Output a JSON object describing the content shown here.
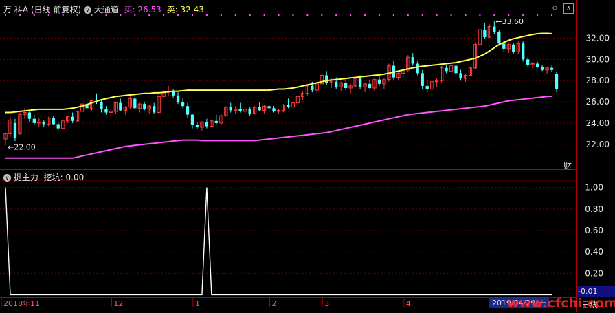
{
  "header": {
    "stock": "万 科A",
    "mode": "(日线 前复权)",
    "indicator": "大通道",
    "buy_label": "买:",
    "buy_value": "26.53",
    "sell_label": "卖:",
    "sell_value": "32.43"
  },
  "finance_tag": "财",
  "lower_header": {
    "indicator": "捉主力",
    "label": "挖坑:",
    "value": "0.00"
  },
  "bottom": {
    "months": [
      "2018年11",
      "12",
      "1",
      "2",
      "3",
      "4"
    ],
    "date_tag": "2019/04/29(一",
    "period": "日线",
    "small_value": "-0.01"
  },
  "watermark": "www.cfchi.com",
  "colors": {
    "background": "#000000",
    "up": "#ff3d3d",
    "down": "#55ffff",
    "upper_band": "#ffff55",
    "lower_band": "#ff55ff",
    "dots": "#ff55ff",
    "axis": "#b00000"
  },
  "chart_data": [
    {
      "type": "candlestick",
      "title": "大通道",
      "ylim": [
        20.3,
        34.3
      ],
      "yticks": [
        22.0,
        24.0,
        26.0,
        28.0,
        30.0,
        32.0
      ],
      "ytick_labels": [
        "22.00",
        "24.00",
        "26.00",
        "28.00",
        "30.00",
        "32.00"
      ],
      "annotations": {
        "high": "33.60",
        "low": "22.00"
      },
      "candles": [
        [
          22.5,
          23.1,
          21.9,
          23.0
        ],
        [
          23.0,
          24.6,
          22.7,
          24.3
        ],
        [
          24.0,
          24.4,
          22.3,
          22.6
        ],
        [
          23.0,
          25.0,
          22.9,
          24.8
        ],
        [
          24.8,
          25.4,
          24.4,
          25.0
        ],
        [
          25.0,
          25.2,
          24.1,
          24.4
        ],
        [
          24.4,
          24.8,
          23.8,
          24.0
        ],
        [
          24.0,
          24.5,
          23.6,
          24.1
        ],
        [
          24.1,
          24.3,
          23.6,
          23.9
        ],
        [
          23.9,
          24.6,
          23.7,
          24.5
        ],
        [
          24.5,
          24.7,
          23.8,
          23.9
        ],
        [
          23.9,
          24.1,
          23.3,
          23.5
        ],
        [
          23.5,
          24.3,
          23.4,
          24.2
        ],
        [
          24.2,
          24.7,
          24.0,
          24.6
        ],
        [
          24.6,
          25.0,
          24.0,
          24.2
        ],
        [
          24.2,
          25.2,
          24.1,
          25.1
        ],
        [
          25.1,
          26.0,
          24.9,
          25.8
        ],
        [
          25.8,
          26.4,
          25.2,
          25.4
        ],
        [
          25.4,
          26.2,
          25.1,
          26.1
        ],
        [
          26.1,
          26.8,
          25.8,
          26.0
        ],
        [
          26.0,
          26.2,
          25.0,
          25.3
        ],
        [
          25.3,
          25.6,
          24.8,
          25.0
        ],
        [
          25.0,
          25.3,
          24.6,
          25.1
        ],
        [
          25.1,
          26.0,
          24.9,
          25.9
        ],
        [
          25.9,
          26.3,
          25.1,
          25.2
        ],
        [
          25.2,
          25.6,
          24.8,
          25.5
        ],
        [
          25.5,
          26.5,
          25.3,
          26.3
        ],
        [
          26.3,
          26.7,
          25.3,
          25.4
        ],
        [
          25.4,
          25.9,
          25.0,
          25.8
        ],
        [
          25.8,
          26.0,
          25.2,
          25.3
        ],
        [
          25.3,
          25.7,
          24.9,
          25.6
        ],
        [
          25.6,
          25.9,
          24.9,
          25.0
        ],
        [
          25.0,
          26.7,
          24.9,
          26.5
        ],
        [
          26.5,
          27.1,
          26.3,
          26.9
        ],
        [
          26.9,
          27.5,
          26.5,
          27.0
        ],
        [
          27.0,
          27.2,
          26.4,
          26.6
        ],
        [
          26.6,
          26.9,
          25.8,
          26.0
        ],
        [
          26.0,
          26.3,
          25.4,
          25.6
        ],
        [
          25.6,
          25.9,
          24.5,
          24.8
        ],
        [
          24.8,
          24.9,
          23.5,
          23.8
        ],
        [
          23.8,
          24.1,
          23.4,
          23.6
        ],
        [
          23.6,
          24.2,
          23.3,
          24.1
        ],
        [
          24.1,
          24.4,
          23.5,
          23.7
        ],
        [
          23.7,
          24.3,
          23.6,
          24.2
        ],
        [
          24.2,
          24.8,
          23.9,
          24.0
        ],
        [
          24.0,
          24.9,
          23.8,
          24.7
        ],
        [
          24.7,
          25.6,
          24.6,
          25.5
        ],
        [
          25.5,
          25.9,
          25.0,
          25.2
        ],
        [
          25.2,
          25.6,
          24.9,
          25.3
        ],
        [
          25.3,
          25.9,
          25.0,
          25.1
        ],
        [
          25.1,
          25.4,
          24.8,
          25.3
        ],
        [
          25.3,
          25.5,
          24.7,
          24.9
        ],
        [
          24.9,
          25.6,
          24.8,
          25.5
        ],
        [
          25.5,
          26.0,
          25.1,
          25.2
        ],
        [
          25.2,
          25.7,
          24.9,
          25.6
        ],
        [
          25.6,
          25.8,
          25.0,
          25.4
        ],
        [
          25.4,
          25.6,
          25.0,
          25.1
        ],
        [
          25.1,
          25.3,
          24.9,
          25.2
        ],
        [
          25.2,
          25.8,
          25.0,
          25.7
        ],
        [
          25.7,
          26.3,
          25.4,
          25.5
        ],
        [
          25.5,
          26.0,
          25.3,
          25.9
        ],
        [
          25.9,
          26.6,
          25.8,
          26.5
        ],
        [
          26.5,
          27.0,
          26.2,
          26.8
        ],
        [
          26.8,
          27.6,
          26.6,
          27.5
        ],
        [
          27.5,
          27.9,
          26.9,
          27.1
        ],
        [
          27.1,
          27.8,
          26.7,
          27.7
        ],
        [
          27.7,
          28.7,
          27.5,
          28.5
        ],
        [
          28.5,
          28.9,
          27.6,
          27.8
        ],
        [
          27.8,
          28.2,
          27.3,
          27.9
        ],
        [
          27.9,
          28.3,
          27.2,
          27.4
        ],
        [
          27.4,
          27.9,
          27.0,
          27.8
        ],
        [
          27.8,
          28.1,
          27.1,
          27.3
        ],
        [
          27.3,
          27.7,
          26.8,
          27.5
        ],
        [
          27.5,
          28.3,
          27.4,
          28.2
        ],
        [
          28.2,
          28.5,
          27.2,
          27.4
        ],
        [
          27.4,
          27.8,
          26.9,
          27.7
        ],
        [
          27.7,
          28.1,
          27.2,
          27.3
        ],
        [
          27.3,
          28.3,
          27.0,
          28.1
        ],
        [
          28.1,
          28.6,
          27.5,
          27.7
        ],
        [
          27.7,
          28.2,
          27.2,
          28.1
        ],
        [
          28.1,
          29.6,
          27.9,
          29.4
        ],
        [
          29.4,
          29.9,
          28.1,
          28.3
        ],
        [
          28.3,
          28.9,
          28.0,
          28.7
        ],
        [
          28.7,
          29.2,
          28.3,
          29.0
        ],
        [
          29.0,
          30.4,
          28.8,
          30.2
        ],
        [
          30.2,
          30.6,
          29.4,
          29.6
        ],
        [
          29.6,
          29.9,
          28.5,
          28.7
        ],
        [
          28.7,
          29.0,
          27.2,
          27.5
        ],
        [
          27.5,
          28.0,
          26.9,
          27.2
        ],
        [
          27.2,
          28.1,
          27.0,
          27.9
        ],
        [
          27.9,
          28.2,
          27.4,
          28.0
        ],
        [
          28.0,
          29.4,
          27.8,
          29.2
        ],
        [
          29.2,
          29.5,
          28.7,
          28.9
        ],
        [
          28.9,
          29.6,
          28.8,
          29.4
        ],
        [
          29.4,
          29.8,
          28.5,
          28.7
        ],
        [
          28.7,
          29.0,
          28.0,
          28.2
        ],
        [
          28.2,
          28.6,
          27.9,
          28.5
        ],
        [
          28.5,
          29.3,
          28.4,
          29.2
        ],
        [
          29.2,
          31.6,
          29.1,
          31.4
        ],
        [
          31.4,
          33.0,
          31.2,
          32.8
        ],
        [
          32.8,
          33.4,
          31.9,
          32.1
        ],
        [
          32.1,
          33.3,
          32.0,
          33.1
        ],
        [
          33.1,
          33.6,
          32.4,
          32.6
        ],
        [
          32.6,
          32.8,
          31.3,
          31.5
        ],
        [
          31.5,
          31.8,
          30.7,
          31.0
        ],
        [
          31.0,
          31.6,
          30.6,
          31.4
        ],
        [
          31.4,
          31.5,
          30.5,
          30.7
        ],
        [
          30.7,
          31.7,
          30.5,
          31.5
        ],
        [
          31.5,
          31.7,
          29.8,
          30.0
        ],
        [
          30.0,
          30.2,
          29.3,
          29.5
        ],
        [
          29.5,
          29.8,
          29.1,
          29.6
        ],
        [
          29.6,
          29.8,
          29.2,
          29.3
        ],
        [
          29.3,
          29.5,
          28.9,
          29.0
        ],
        [
          29.0,
          29.3,
          28.6,
          29.2
        ],
        [
          29.2,
          29.4,
          28.8,
          29.0
        ],
        [
          28.6,
          28.8,
          26.9,
          27.2
        ]
      ],
      "upper_band": [
        25.0,
        25.0,
        25.05,
        25.1,
        25.15,
        25.2,
        25.25,
        25.3,
        25.3,
        25.3,
        25.3,
        25.3,
        25.3,
        25.35,
        25.4,
        25.5,
        25.6,
        25.75,
        25.9,
        26.05,
        26.2,
        26.3,
        26.4,
        26.5,
        26.55,
        26.6,
        26.65,
        26.7,
        26.75,
        26.8,
        26.8,
        26.85,
        26.85,
        26.9,
        26.95,
        27.0,
        27.0,
        27.05,
        27.1,
        27.1,
        27.1,
        27.1,
        27.1,
        27.1,
        27.1,
        27.1,
        27.1,
        27.1,
        27.1,
        27.1,
        27.1,
        27.1,
        27.1,
        27.1,
        27.1,
        27.1,
        27.15,
        27.2,
        27.2,
        27.25,
        27.3,
        27.4,
        27.5,
        27.6,
        27.7,
        27.8,
        27.9,
        28.0,
        28.05,
        28.1,
        28.15,
        28.2,
        28.25,
        28.3,
        28.35,
        28.4,
        28.45,
        28.5,
        28.55,
        28.6,
        28.7,
        28.8,
        28.9,
        29.0,
        29.1,
        29.2,
        29.3,
        29.35,
        29.4,
        29.45,
        29.5,
        29.55,
        29.6,
        29.65,
        29.7,
        29.8,
        29.9,
        30.0,
        30.1,
        30.3,
        30.5,
        30.8,
        31.1,
        31.4,
        31.6,
        31.8,
        31.95,
        32.05,
        32.15,
        32.25,
        32.35,
        32.42,
        32.45,
        32.45,
        32.43
      ],
      "lower_band": [
        20.7,
        20.7,
        20.7,
        20.7,
        20.7,
        20.7,
        20.7,
        20.7,
        20.7,
        20.7,
        20.7,
        20.7,
        20.7,
        20.7,
        20.7,
        20.8,
        20.9,
        21.0,
        21.1,
        21.2,
        21.3,
        21.4,
        21.5,
        21.6,
        21.7,
        21.8,
        21.85,
        21.9,
        21.95,
        22.0,
        22.05,
        22.1,
        22.15,
        22.2,
        22.25,
        22.3,
        22.35,
        22.4,
        22.4,
        22.4,
        22.4,
        22.35,
        22.35,
        22.35,
        22.35,
        22.35,
        22.35,
        22.35,
        22.35,
        22.35,
        22.35,
        22.35,
        22.35,
        22.4,
        22.45,
        22.5,
        22.55,
        22.6,
        22.65,
        22.7,
        22.75,
        22.8,
        22.85,
        22.9,
        22.95,
        23.0,
        23.05,
        23.1,
        23.2,
        23.3,
        23.4,
        23.5,
        23.6,
        23.7,
        23.8,
        23.9,
        24.0,
        24.1,
        24.2,
        24.3,
        24.4,
        24.5,
        24.6,
        24.7,
        24.8,
        24.85,
        24.9,
        24.95,
        25.0,
        25.05,
        25.1,
        25.15,
        25.2,
        25.25,
        25.3,
        25.35,
        25.4,
        25.45,
        25.5,
        25.55,
        25.6,
        25.7,
        25.8,
        25.9,
        26.0,
        26.1,
        26.15,
        26.2,
        26.25,
        26.3,
        26.35,
        26.4,
        26.45,
        26.5,
        26.53
      ]
    },
    {
      "type": "line",
      "title": "捉主力",
      "ylim": [
        -0.01,
        1.03
      ],
      "yticks": [
        0.2,
        0.4,
        0.6,
        0.8,
        1.0
      ],
      "ytick_labels": [
        "0.20",
        "0.40",
        "0.60",
        "0.80",
        "1.00"
      ],
      "series": [
        {
          "name": "挖坑",
          "values": [
            1,
            0,
            0,
            0,
            0,
            0,
            0,
            0,
            0,
            0,
            0,
            0,
            0,
            0,
            0,
            0,
            0,
            0,
            0,
            0,
            0,
            0,
            0,
            0,
            0,
            0,
            0,
            0,
            0,
            0,
            0,
            0,
            0,
            0,
            0,
            0,
            0,
            0,
            0,
            0,
            0,
            0,
            1,
            0,
            0,
            0,
            0,
            0,
            0,
            0,
            0,
            0,
            0,
            0,
            0,
            0,
            0,
            0,
            0,
            0,
            0,
            0,
            0,
            0,
            0,
            0,
            0,
            0,
            0,
            0,
            0,
            0,
            0,
            0,
            0,
            0,
            0,
            0,
            0,
            0,
            0,
            0,
            0,
            0,
            0,
            0,
            0,
            0,
            0,
            0,
            0,
            0,
            0,
            0,
            0,
            0,
            0,
            0,
            0,
            0,
            0,
            0,
            0,
            0,
            0,
            0,
            0,
            0,
            0,
            0,
            0,
            0,
            0,
            0,
            0
          ]
        }
      ]
    }
  ]
}
